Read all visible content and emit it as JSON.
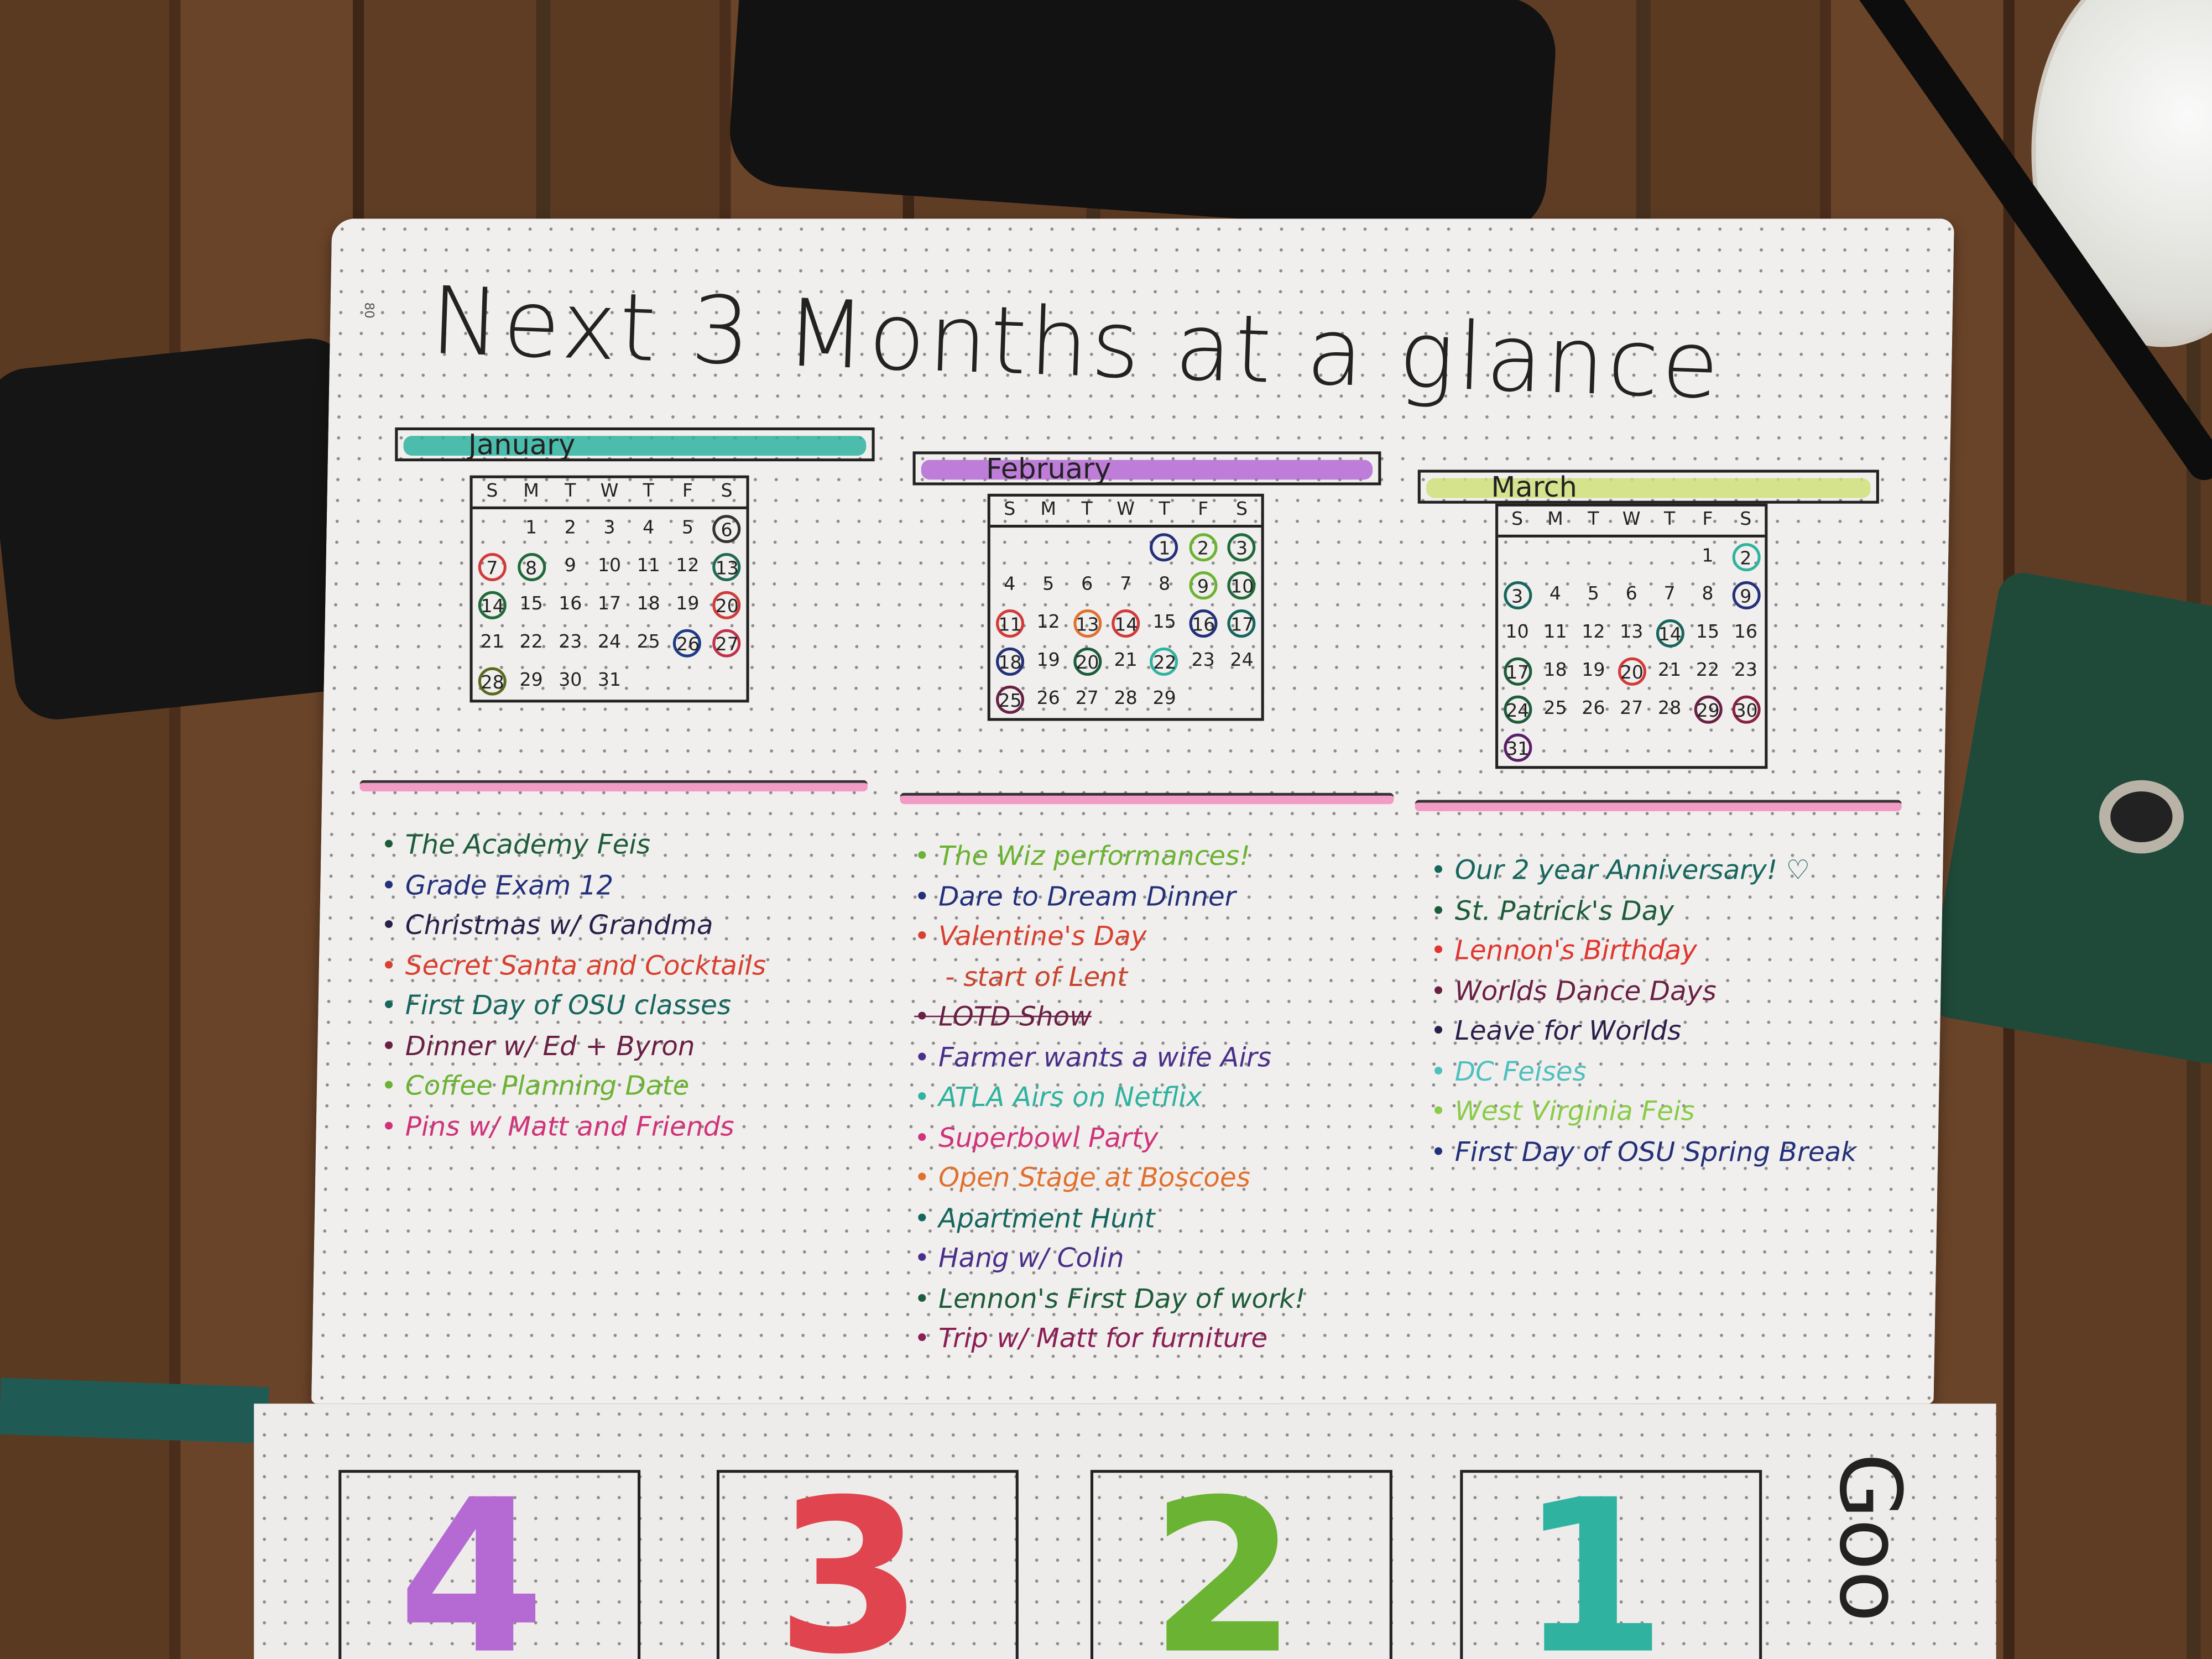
{
  "page_number": "80",
  "title": "Next 3 Months at a glance",
  "weekdays": [
    "S",
    "M",
    "T",
    "W",
    "T",
    "F",
    "S"
  ],
  "months": [
    {
      "name": "January",
      "color": "#2fb3a0",
      "start": 1,
      "days": 31,
      "circled": {
        "6": "#333",
        "7": "#d23a3a",
        "8": "#1f6a3a",
        "13": "#1f6a55",
        "14": "#1f6a3a",
        "20": "#d23a3a",
        "26": "#1d3b8a",
        "27": "#c2304a",
        "28": "#5a6a20"
      },
      "events": [
        {
          "text": "The Academy Feis",
          "color": "#1d5c3a"
        },
        {
          "text": "Grade Exam 12",
          "color": "#23307a"
        },
        {
          "text": "Christmas w/ Grandma",
          "color": "#2a1f4a"
        },
        {
          "text": "Secret Santa and Cocktails",
          "color": "#d8402f"
        },
        {
          "text": "First Day of OSU classes",
          "color": "#16665e"
        },
        {
          "text": "Dinner w/ Ed + Byron",
          "color": "#6a1f45"
        },
        {
          "text": "Coffee Planning Date",
          "color": "#6ab333"
        },
        {
          "text": "Pins w/ Matt and Friends",
          "color": "#d0337a"
        }
      ]
    },
    {
      "name": "February",
      "color": "#b569d3",
      "start": 4,
      "days": 29,
      "circled": {
        "1": "#23307a",
        "2": "#6ab333",
        "3": "#1f6a3a",
        "9": "#6ab333",
        "10": "#1f6a3a",
        "11": "#d23a3a",
        "13": "#e0702f",
        "14": "#d23a3a",
        "16": "#23307a",
        "17": "#16665e",
        "18": "#23307a",
        "20": "#1d5c3a",
        "22": "#2fb3a0",
        "25": "#6a1f45"
      },
      "events": [
        {
          "text": "The Wiz performances!",
          "color": "#6ab333"
        },
        {
          "text": "Dare to Dream Dinner",
          "color": "#23307a"
        },
        {
          "text": "Valentine's Day",
          "color": "#d8402f"
        },
        {
          "text": "- start of Lent",
          "color": "#c8452f",
          "sub": true
        },
        {
          "text": "LOTD Show",
          "color": "#6a1f45",
          "struck": true
        },
        {
          "text": "Farmer wants a wife Airs",
          "color": "#4a2f8a"
        },
        {
          "text": "ATLA Airs on Netflix",
          "color": "#2fb3a0"
        },
        {
          "text": "Superbowl Party",
          "color": "#d0337a"
        },
        {
          "text": "Open Stage at Boscoes",
          "color": "#e0702f"
        },
        {
          "text": "Apartment Hunt",
          "color": "#16665e"
        },
        {
          "text": "Hang w/ Colin",
          "color": "#4a2f8a"
        },
        {
          "text": "Lennon's First Day of work!",
          "color": "#1d5c3a"
        },
        {
          "text": "Trip w/ Matt for furniture",
          "color": "#8a1f55"
        }
      ]
    },
    {
      "name": "March",
      "color": "#cfe07a",
      "start": 5,
      "days": 31,
      "circled": {
        "2": "#2fb3a0",
        "3": "#16665e",
        "9": "#23307a",
        "14": "#16665e",
        "17": "#1d5c3a",
        "20": "#d23a3a",
        "24": "#1d5c3a",
        "29": "#6a1f45",
        "30": "#8a1f45",
        "31": "#5a1f6a"
      },
      "events": [
        {
          "text": "Our 2 year Anniversary! ♡",
          "color": "#16665e"
        },
        {
          "text": "St. Patrick's Day",
          "color": "#1d5c3a"
        },
        {
          "text": "Lennon's Birthday",
          "color": "#e0362f"
        },
        {
          "text": "Worlds Dance Days",
          "color": "#6a1f45"
        },
        {
          "text": "Leave for Worlds",
          "color": "#2a1f4a"
        },
        {
          "text": "DC Feises",
          "color": "#4fc0c0"
        },
        {
          "text": "West Virginia Feis",
          "color": "#8acb4a"
        },
        {
          "text": "First Day of OSU Spring Break",
          "color": "#23307a"
        }
      ]
    }
  ],
  "countdown": [
    {
      "text": "4",
      "color": "#b569d3"
    },
    {
      "text": "3",
      "color": "#e0454f"
    },
    {
      "text": "2",
      "color": "#6ab333"
    },
    {
      "text": "1",
      "color": "#2fb3a0"
    }
  ],
  "bottom_heading": "Goo"
}
